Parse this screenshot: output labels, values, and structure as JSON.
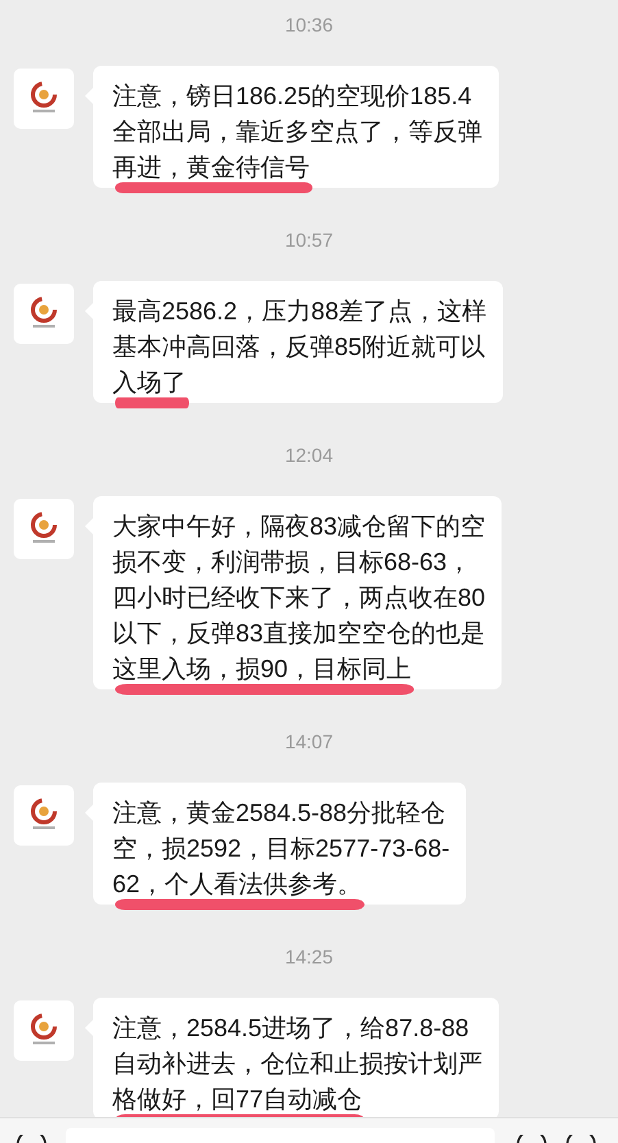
{
  "messages": [
    {
      "time": "10:36",
      "lines": [
        "注意，镑日186.25的空现价185.4",
        "全部出局，靠近多空点了，等反弹",
        "再进，黄金待信号"
      ]
    },
    {
      "time": "10:57",
      "lines": [
        "最高2586.2，压力88差了点，这样",
        "基本冲高回落，反弹85附近就可以",
        "入场了"
      ]
    },
    {
      "time": "12:04",
      "lines": [
        "大家中午好，隔夜83减仓留下的空",
        "损不变，利润带损，目标68-63，",
        "四小时已经收下来了，两点收在80",
        "以下，反弹83直接加空空仓的也是",
        "这里入场，损90，目标同上"
      ]
    },
    {
      "time": "14:07",
      "lines": [
        "注意，黄金2584.5-88分批轻仓",
        "空，损2592，目标2577-73-68-",
        "62，个人看法供参考。"
      ]
    },
    {
      "time": "14:25",
      "lines": [
        "注意，2584.5进场了，给87.8-88",
        "自动补进去，仓位和止损按计划严",
        "格做好，回77自动减仓"
      ]
    }
  ]
}
